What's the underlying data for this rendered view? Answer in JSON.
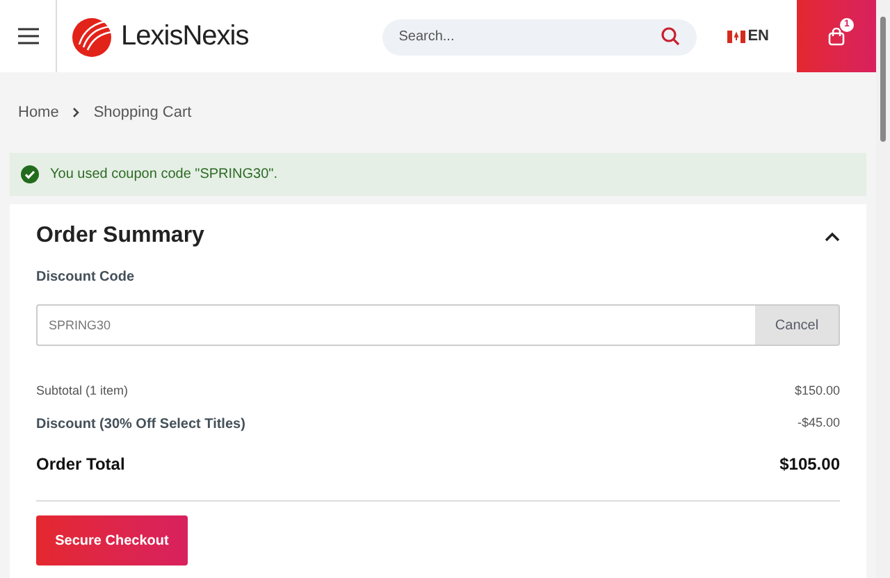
{
  "header": {
    "logo": "LexisNexis",
    "search": {
      "placeholder": "Search..."
    },
    "language": "EN",
    "cart_count": "1"
  },
  "breadcrumb": [
    "Home",
    "Shopping Cart"
  ],
  "alert": {
    "text": "You used coupon code \"SPRING30\"."
  },
  "order_summary": {
    "title": "Order Summary",
    "expanded": true,
    "discount_label": "Discount Code",
    "discount_value": "SPRING30",
    "cancel_button": "Cancel",
    "lines": [
      {
        "kind": "minor",
        "label": "Subtotal (1 item)",
        "value": "$150.00"
      },
      {
        "kind": "discount",
        "label": "Discount (30% Off Select Titles)",
        "value": "-$45.00"
      },
      {
        "kind": "total",
        "label": "Order Total",
        "value": "$105.00"
      }
    ],
    "checkout_button": "Secure Checkout"
  }
}
